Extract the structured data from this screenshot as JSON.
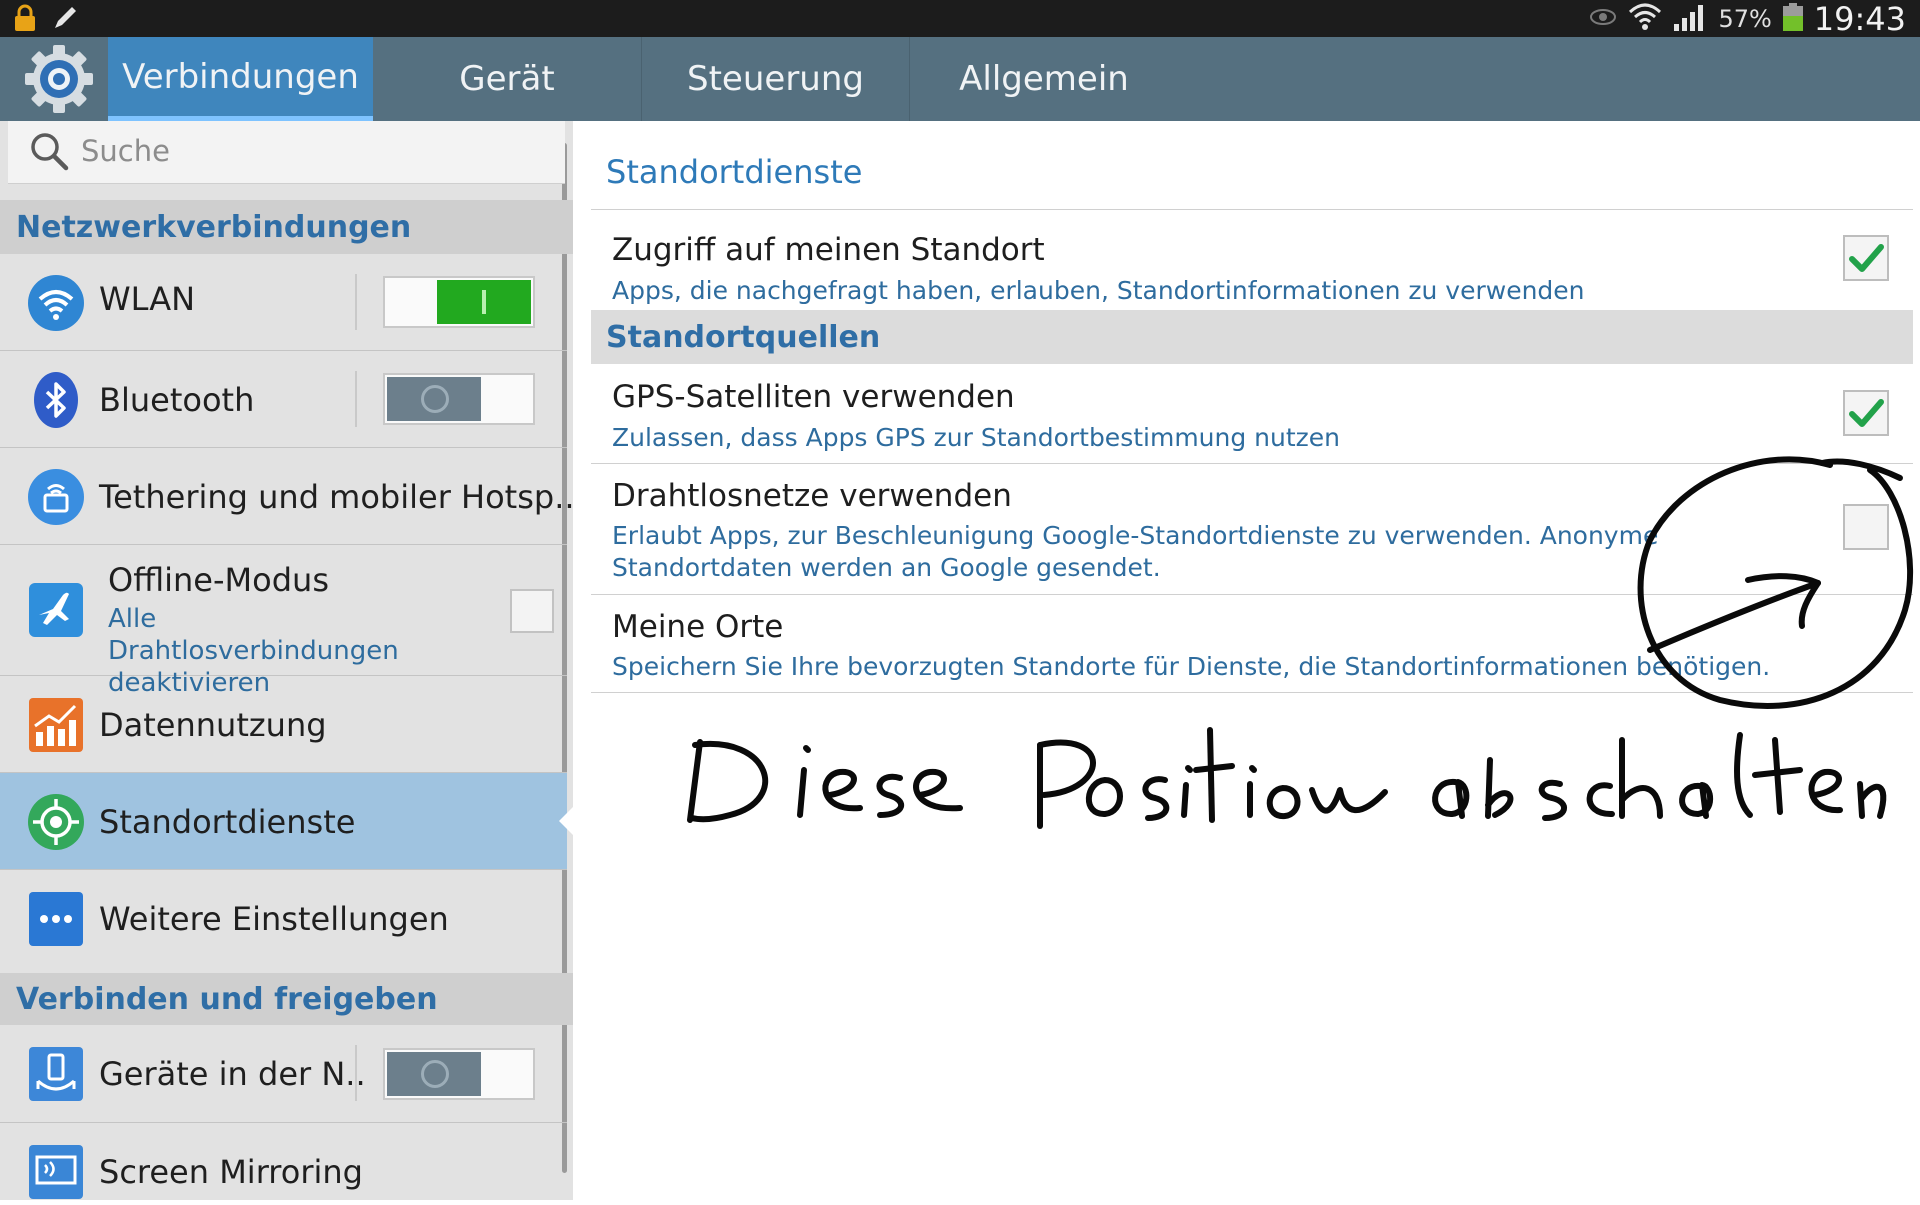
{
  "status_bar": {
    "left_icons": [
      "lock-icon",
      "pencil-icon"
    ],
    "right_icons": [
      "eye-icon",
      "wifi-icon",
      "signal-icon",
      "battery-icon"
    ],
    "battery": "57%",
    "time": "19:43"
  },
  "action_bar": {
    "app_icon": "settings-gear-icon",
    "tabs": [
      {
        "label": "Verbindungen",
        "selected": true
      },
      {
        "label": "Gerät"
      },
      {
        "label": "Steuerung"
      },
      {
        "label": "Allgemein"
      }
    ]
  },
  "left": {
    "search_placeholder": "Suche",
    "sections": [
      "Netzwerkverbindungen",
      "Verbinden und freigeben"
    ],
    "items": [
      {
        "label": "WLAN",
        "icon": "wifi-icon",
        "toggle": "on"
      },
      {
        "label": "Bluetooth",
        "icon": "bluetooth-icon",
        "toggle": "off"
      },
      {
        "label": "Tethering und mobiler Hotsp..",
        "icon": "tethering-icon"
      },
      {
        "label": "Offline-Modus",
        "sub": "Alle Drahtlosverbindungen deaktivieren",
        "icon": "airplane-icon",
        "checked": false
      },
      {
        "label": "Datennutzung",
        "icon": "data-usage-icon"
      },
      {
        "label": "Standortdienste",
        "icon": "location-icon",
        "selected": true
      },
      {
        "label": "Weitere Einstellungen",
        "icon": "more-icon"
      },
      {
        "label": "Geräte in der N..",
        "icon": "nearby-devices-icon",
        "toggle": "off"
      },
      {
        "label": "Screen Mirroring",
        "icon": "screen-mirroring-icon"
      }
    ]
  },
  "right": {
    "title": "Standortdienste",
    "access": {
      "title": "Zugriff auf meinen Standort",
      "sub": "Apps, die nachgefragt haben, erlauben, Standortinformationen zu verwenden",
      "checked": true
    },
    "section": "Standortquellen",
    "gps": {
      "title": "GPS-Satelliten verwenden",
      "sub": "Zulassen, dass Apps GPS zur Standortbestimmung nutzen",
      "checked": true
    },
    "wireless": {
      "title": "Drahtlosnetze verwenden",
      "sub": "Erlaubt Apps, zur Beschleunigung Google-Standortdienste zu verwenden. Anonyme Standortdaten werden an Google gesendet.",
      "checked": false
    },
    "places": {
      "title": "Meine Orte",
      "sub": "Speichern Sie Ihre bevorzugten Standorte für Dienste, die Standortinformationen benötigen."
    }
  },
  "annotation": {
    "handwritten_note": "Diese Position abschalten"
  },
  "colors": {
    "action_bar": "#557080",
    "tab_selected": "#3f86bd",
    "accent_blue": "#2e7ab8",
    "toggle_on": "#22a91f",
    "check_green": "#22a24a"
  }
}
